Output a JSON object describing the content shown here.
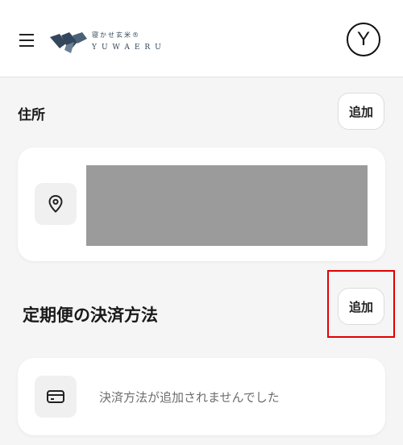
{
  "header": {
    "logo_jp": "寝かせ玄米®",
    "logo_en": "YUWAERU",
    "avatar_initial": "Y"
  },
  "address_section": {
    "title": "住所",
    "add_label": "追加"
  },
  "payment_section": {
    "title": "定期便の決済方法",
    "add_label": "追加",
    "empty_message": "決済方法が追加されませんでした"
  },
  "colors": {
    "highlight": "#e00000",
    "logo": "#33465c"
  }
}
